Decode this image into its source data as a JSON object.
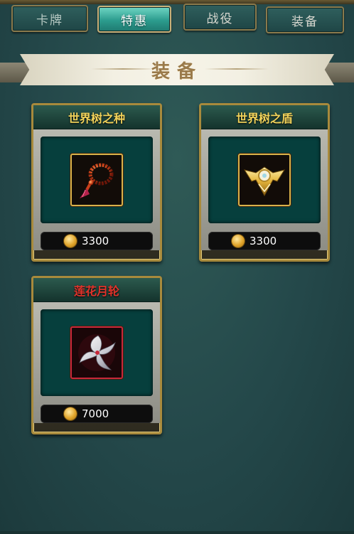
{
  "tabs": [
    {
      "label": "卡牌",
      "active": false
    },
    {
      "label": "特惠",
      "active": true
    },
    {
      "label": "战役",
      "active": false
    },
    {
      "label": "装备",
      "active": false
    }
  ],
  "section": {
    "title": "装备"
  },
  "items": [
    {
      "name": "世界树之种",
      "price": "3300",
      "icon": "prayer-beads-icon",
      "name_color": "#f1d25a"
    },
    {
      "name": "世界树之盾",
      "price": "3300",
      "icon": "golden-shield-emblem-icon",
      "name_color": "#f1d25a"
    },
    {
      "name": "莲花月轮",
      "price": "7000",
      "icon": "crescent-blade-wheel-icon",
      "name_color": "#e0332b"
    }
  ],
  "currency_icon": "gold-coin-icon",
  "colors": {
    "background": "#24484a",
    "active_tab": "#2c9c8e",
    "card_border": "#a88a3c",
    "panel": "#063f3d"
  }
}
